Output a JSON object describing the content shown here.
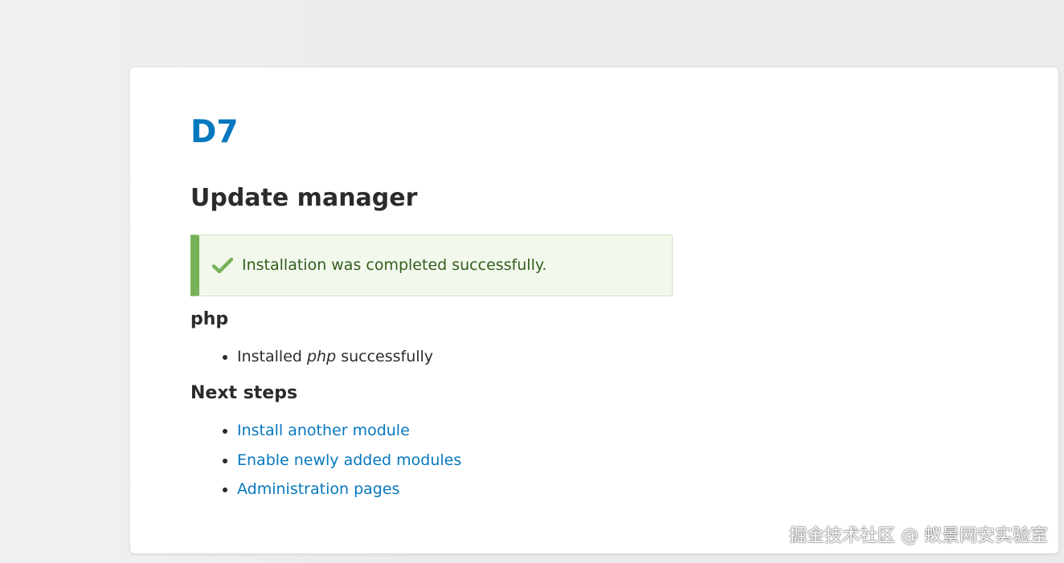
{
  "site": {
    "name": "D7"
  },
  "page": {
    "title": "Update manager"
  },
  "message": {
    "icon": "check-icon",
    "text": "Installation was completed successfully.",
    "accent_color": "#77b259",
    "background_color": "#f3f8ed"
  },
  "project": {
    "name": "php",
    "result_prefix": "Installed ",
    "result_project": "php",
    "result_suffix": " successfully"
  },
  "next_steps": {
    "heading": "Next steps",
    "links": [
      {
        "label": "Install another module"
      },
      {
        "label": "Enable newly added modules"
      },
      {
        "label": "Administration pages"
      }
    ]
  },
  "watermark": {
    "text": "掘金技术社区 @ 蚁景网安实验室"
  },
  "colors": {
    "link": "#0678be",
    "text": "#2b2b2b"
  }
}
